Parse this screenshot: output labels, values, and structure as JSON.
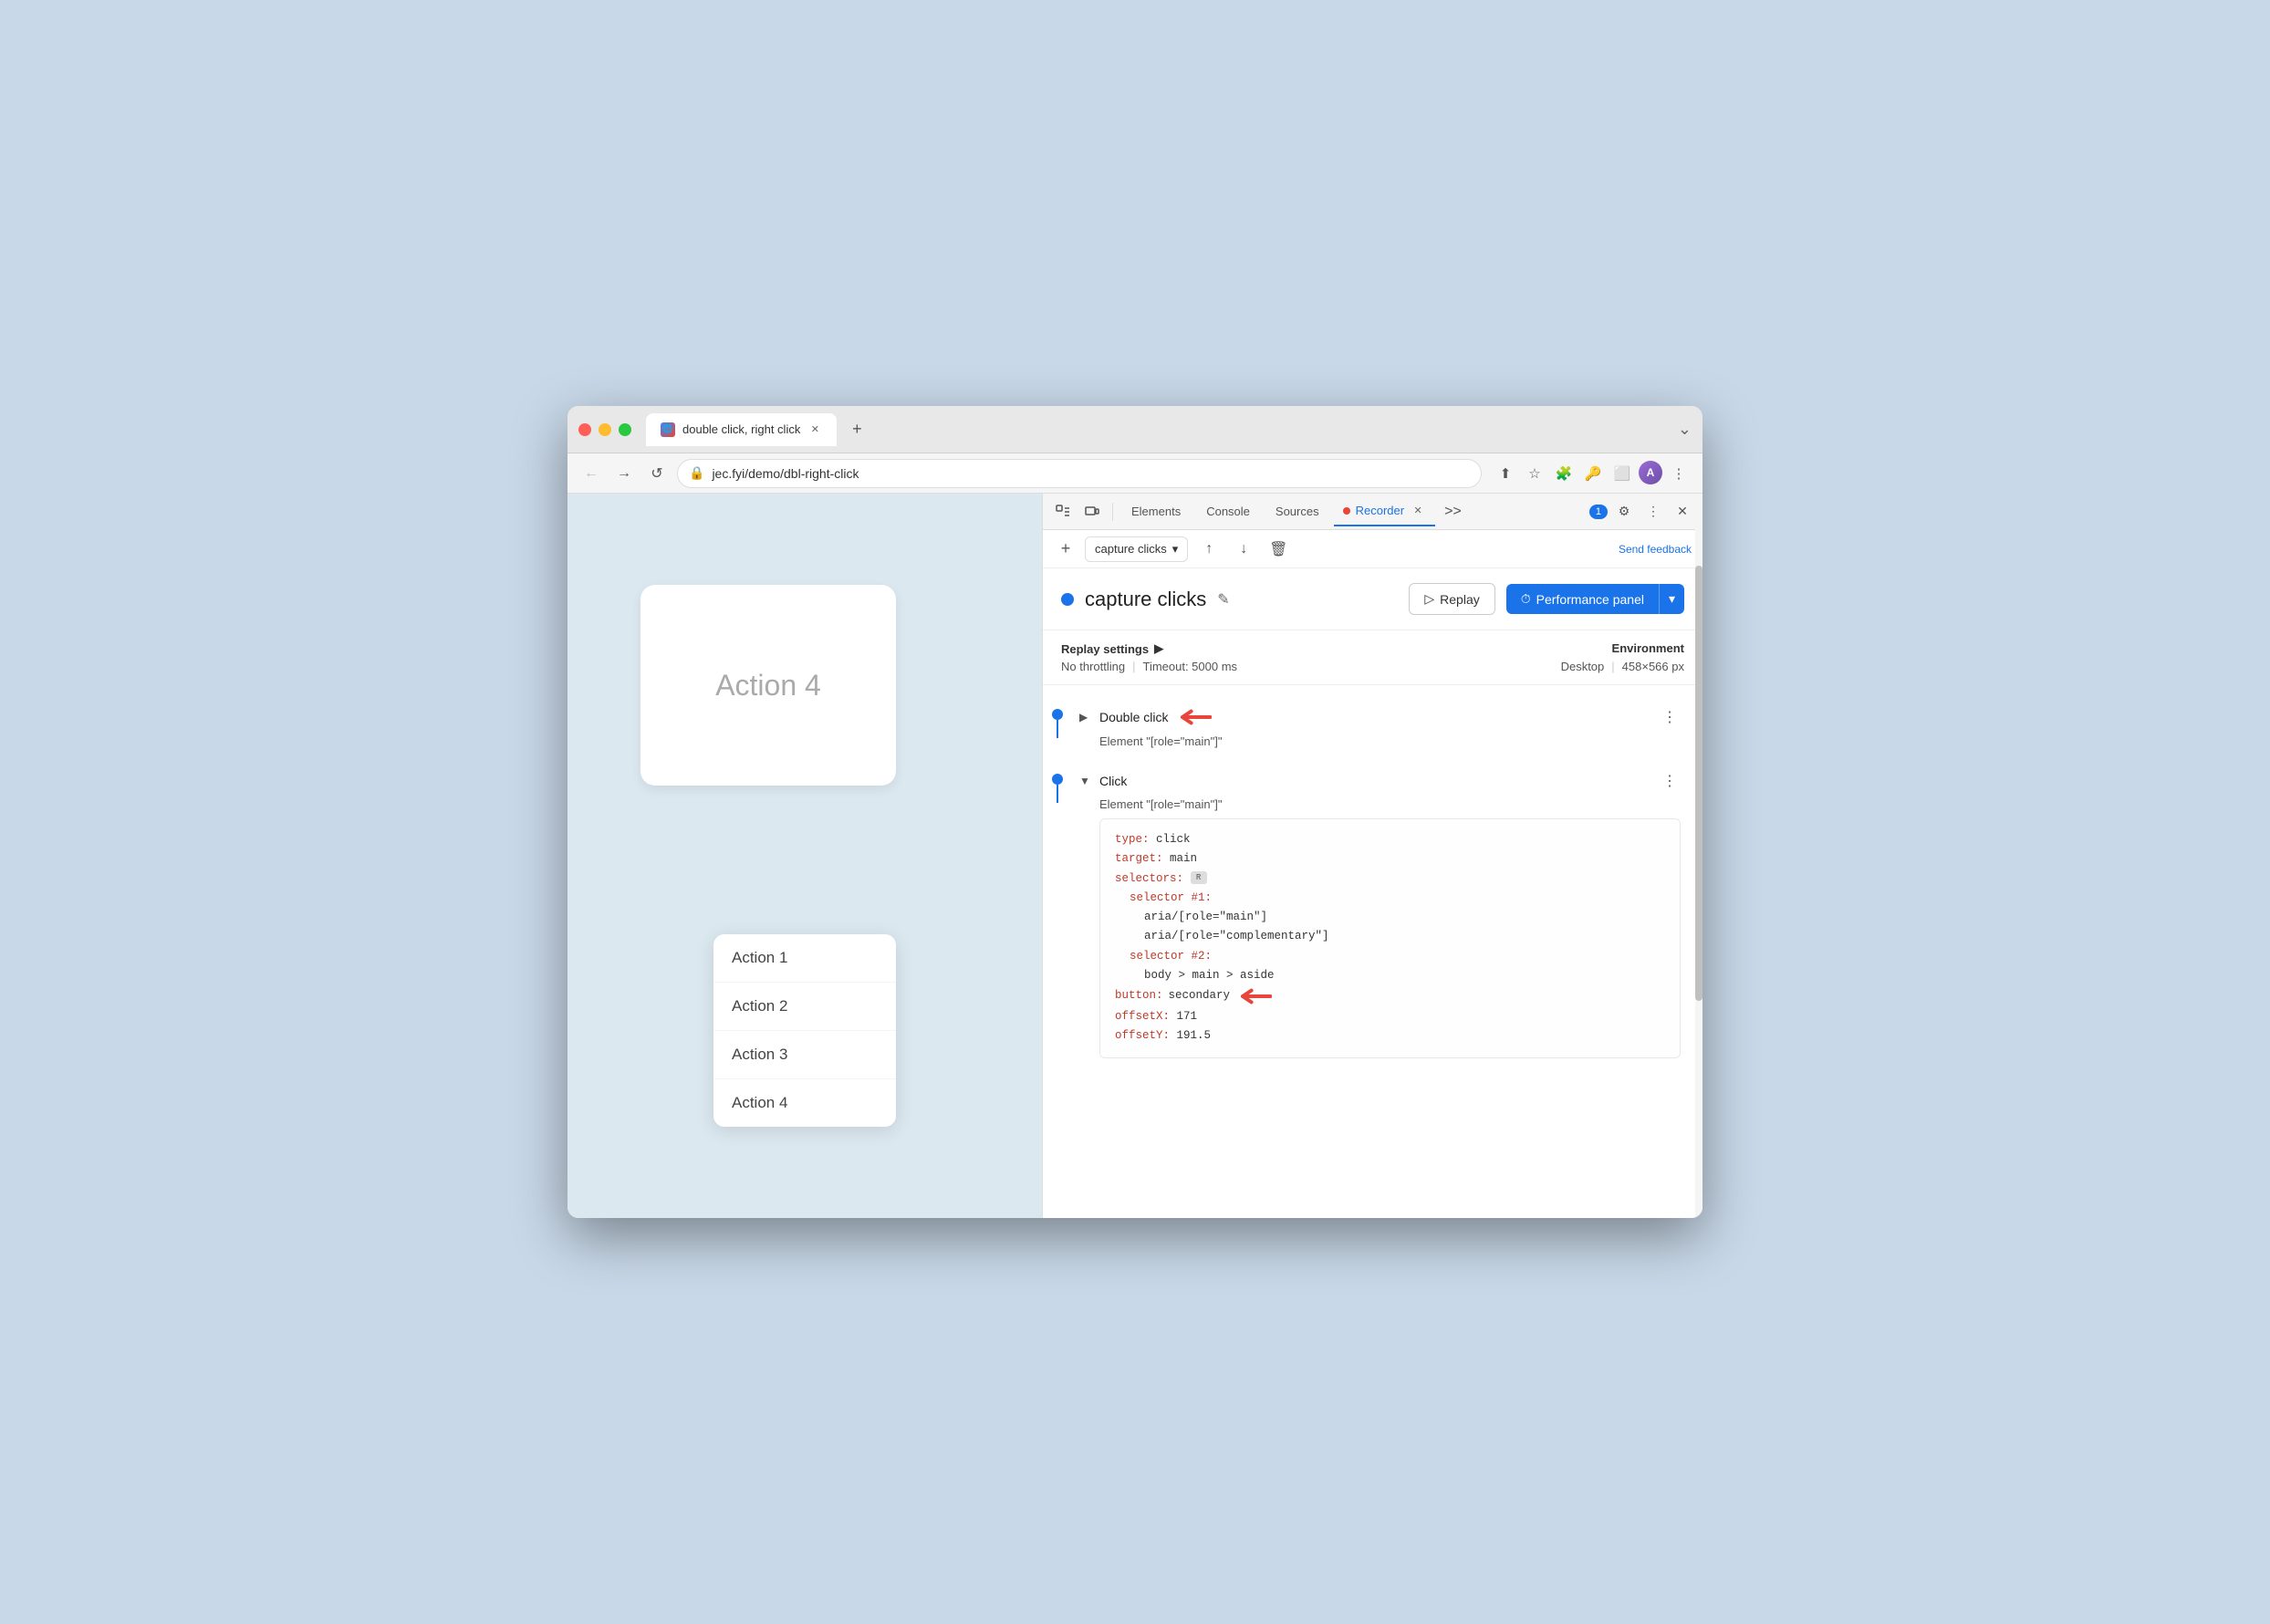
{
  "browser": {
    "tab": {
      "title": "double click, right click",
      "favicon": "🌐"
    },
    "address": "jec.fyi/demo/dbl-right-click"
  },
  "devtools": {
    "tabs": [
      "Elements",
      "Console",
      "Sources",
      "Recorder",
      "»"
    ],
    "active_tab": "Recorder",
    "badge_count": "1",
    "send_feedback": "Send feedback"
  },
  "recorder": {
    "recording_name": "capture clicks",
    "edit_label": "✎",
    "replay_label": "Replay",
    "performance_panel_label": "Performance panel",
    "toolbar": {
      "add_label": "+",
      "dropdown_label": "capture clicks",
      "export_label": "↑",
      "import_label": "↓",
      "delete_label": "🗑"
    },
    "settings": {
      "replay_settings_label": "Replay settings",
      "no_throttling": "No throttling",
      "timeout_label": "Timeout: 5000 ms",
      "environment_label": "Environment",
      "desktop_label": "Desktop",
      "dimensions": "458×566 px"
    },
    "steps": [
      {
        "id": "step1",
        "type": "Double click",
        "element": "Element \"[role=\"main\"]\"",
        "expanded": false,
        "has_arrow": true
      },
      {
        "id": "step2",
        "type": "Click",
        "element": "Element \"[role=\"main\"]\"",
        "expanded": true,
        "has_arrow": false,
        "code": {
          "type_key": "type",
          "type_val": "click",
          "target_key": "target",
          "target_val": "main",
          "selectors_key": "selectors",
          "selector1_key": "selector #1:",
          "aria1": "aria/[role=\"main\"]",
          "aria2": "aria/[role=\"complementary\"]",
          "selector2_key": "selector #2:",
          "css": "body > main > aside",
          "button_key": "button",
          "button_val": "secondary",
          "button_has_arrow": true,
          "offsetX_key": "offsetX",
          "offsetX_val": "171",
          "offsetY_key": "offsetY",
          "offsetY_val": "191.5"
        }
      }
    ]
  },
  "page": {
    "card_large_text": "Action 4",
    "menu_items": [
      "Action 1",
      "Action 2",
      "Action 3",
      "Action 4"
    ]
  }
}
